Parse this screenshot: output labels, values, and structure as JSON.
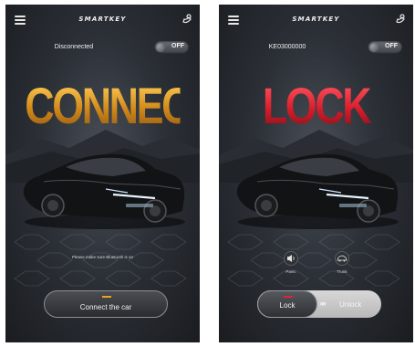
{
  "left": {
    "brand": "SMARTKEY",
    "status": "Disconnected",
    "toggle_label": "OFF",
    "headline": "CONNECT",
    "hint": "Please make sure Bluetooth is on",
    "button_label": "Connect the car"
  },
  "right": {
    "brand": "SMARTKEY",
    "device_id": "KE03000000",
    "toggle_label": "OFF",
    "headline": "LOCK",
    "quick_actions": [
      {
        "label": "Panic",
        "icon": "speaker-icon"
      },
      {
        "label": "Trunk",
        "icon": "car-trunk-icon"
      }
    ],
    "lock_label": "Lock",
    "unlock_label": "Unlock",
    "arrows": "»»"
  },
  "colors": {
    "connect_orange": "#e8a030",
    "lock_red": "#e02434",
    "background_dark": "#2c3037"
  }
}
